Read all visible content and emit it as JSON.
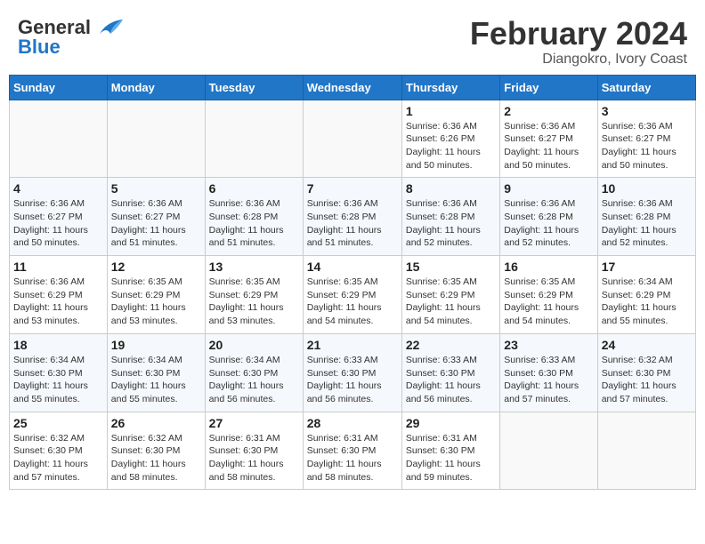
{
  "logo": {
    "line1": "General",
    "line2": "Blue"
  },
  "title": "February 2024",
  "subtitle": "Diangokro, Ivory Coast",
  "weekdays": [
    "Sunday",
    "Monday",
    "Tuesday",
    "Wednesday",
    "Thursday",
    "Friday",
    "Saturday"
  ],
  "weeks": [
    [
      {
        "day": "",
        "info": ""
      },
      {
        "day": "",
        "info": ""
      },
      {
        "day": "",
        "info": ""
      },
      {
        "day": "",
        "info": ""
      },
      {
        "day": "1",
        "info": "Sunrise: 6:36 AM\nSunset: 6:26 PM\nDaylight: 11 hours\nand 50 minutes."
      },
      {
        "day": "2",
        "info": "Sunrise: 6:36 AM\nSunset: 6:27 PM\nDaylight: 11 hours\nand 50 minutes."
      },
      {
        "day": "3",
        "info": "Sunrise: 6:36 AM\nSunset: 6:27 PM\nDaylight: 11 hours\nand 50 minutes."
      }
    ],
    [
      {
        "day": "4",
        "info": "Sunrise: 6:36 AM\nSunset: 6:27 PM\nDaylight: 11 hours\nand 50 minutes."
      },
      {
        "day": "5",
        "info": "Sunrise: 6:36 AM\nSunset: 6:27 PM\nDaylight: 11 hours\nand 51 minutes."
      },
      {
        "day": "6",
        "info": "Sunrise: 6:36 AM\nSunset: 6:28 PM\nDaylight: 11 hours\nand 51 minutes."
      },
      {
        "day": "7",
        "info": "Sunrise: 6:36 AM\nSunset: 6:28 PM\nDaylight: 11 hours\nand 51 minutes."
      },
      {
        "day": "8",
        "info": "Sunrise: 6:36 AM\nSunset: 6:28 PM\nDaylight: 11 hours\nand 52 minutes."
      },
      {
        "day": "9",
        "info": "Sunrise: 6:36 AM\nSunset: 6:28 PM\nDaylight: 11 hours\nand 52 minutes."
      },
      {
        "day": "10",
        "info": "Sunrise: 6:36 AM\nSunset: 6:28 PM\nDaylight: 11 hours\nand 52 minutes."
      }
    ],
    [
      {
        "day": "11",
        "info": "Sunrise: 6:36 AM\nSunset: 6:29 PM\nDaylight: 11 hours\nand 53 minutes."
      },
      {
        "day": "12",
        "info": "Sunrise: 6:35 AM\nSunset: 6:29 PM\nDaylight: 11 hours\nand 53 minutes."
      },
      {
        "day": "13",
        "info": "Sunrise: 6:35 AM\nSunset: 6:29 PM\nDaylight: 11 hours\nand 53 minutes."
      },
      {
        "day": "14",
        "info": "Sunrise: 6:35 AM\nSunset: 6:29 PM\nDaylight: 11 hours\nand 54 minutes."
      },
      {
        "day": "15",
        "info": "Sunrise: 6:35 AM\nSunset: 6:29 PM\nDaylight: 11 hours\nand 54 minutes."
      },
      {
        "day": "16",
        "info": "Sunrise: 6:35 AM\nSunset: 6:29 PM\nDaylight: 11 hours\nand 54 minutes."
      },
      {
        "day": "17",
        "info": "Sunrise: 6:34 AM\nSunset: 6:29 PM\nDaylight: 11 hours\nand 55 minutes."
      }
    ],
    [
      {
        "day": "18",
        "info": "Sunrise: 6:34 AM\nSunset: 6:30 PM\nDaylight: 11 hours\nand 55 minutes."
      },
      {
        "day": "19",
        "info": "Sunrise: 6:34 AM\nSunset: 6:30 PM\nDaylight: 11 hours\nand 55 minutes."
      },
      {
        "day": "20",
        "info": "Sunrise: 6:34 AM\nSunset: 6:30 PM\nDaylight: 11 hours\nand 56 minutes."
      },
      {
        "day": "21",
        "info": "Sunrise: 6:33 AM\nSunset: 6:30 PM\nDaylight: 11 hours\nand 56 minutes."
      },
      {
        "day": "22",
        "info": "Sunrise: 6:33 AM\nSunset: 6:30 PM\nDaylight: 11 hours\nand 56 minutes."
      },
      {
        "day": "23",
        "info": "Sunrise: 6:33 AM\nSunset: 6:30 PM\nDaylight: 11 hours\nand 57 minutes."
      },
      {
        "day": "24",
        "info": "Sunrise: 6:32 AM\nSunset: 6:30 PM\nDaylight: 11 hours\nand 57 minutes."
      }
    ],
    [
      {
        "day": "25",
        "info": "Sunrise: 6:32 AM\nSunset: 6:30 PM\nDaylight: 11 hours\nand 57 minutes."
      },
      {
        "day": "26",
        "info": "Sunrise: 6:32 AM\nSunset: 6:30 PM\nDaylight: 11 hours\nand 58 minutes."
      },
      {
        "day": "27",
        "info": "Sunrise: 6:31 AM\nSunset: 6:30 PM\nDaylight: 11 hours\nand 58 minutes."
      },
      {
        "day": "28",
        "info": "Sunrise: 6:31 AM\nSunset: 6:30 PM\nDaylight: 11 hours\nand 58 minutes."
      },
      {
        "day": "29",
        "info": "Sunrise: 6:31 AM\nSunset: 6:30 PM\nDaylight: 11 hours\nand 59 minutes."
      },
      {
        "day": "",
        "info": ""
      },
      {
        "day": "",
        "info": ""
      }
    ]
  ]
}
